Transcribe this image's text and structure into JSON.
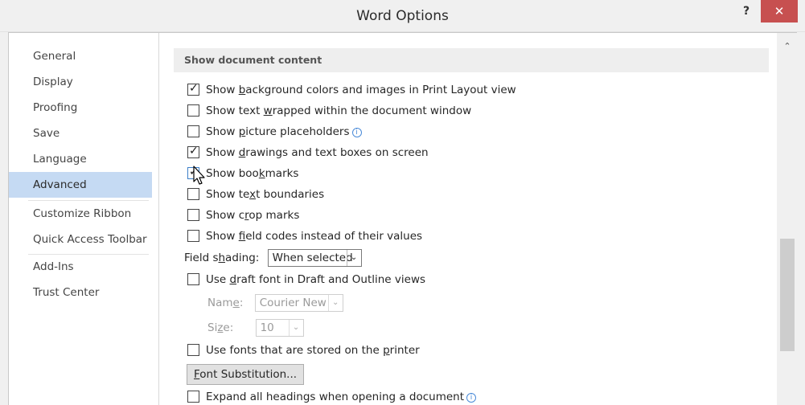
{
  "window": {
    "title": "Word Options",
    "help_label": "?",
    "close_label": "✕"
  },
  "sidebar": {
    "items": [
      {
        "label": "General"
      },
      {
        "label": "Display"
      },
      {
        "label": "Proofing"
      },
      {
        "label": "Save"
      },
      {
        "label": "Language"
      },
      {
        "label": "Advanced",
        "selected": true
      },
      {
        "label": "Customize Ribbon"
      },
      {
        "label": "Quick Access Toolbar"
      },
      {
        "label": "Add-Ins"
      },
      {
        "label": "Trust Center"
      }
    ]
  },
  "main": {
    "section_title": "Show document content",
    "options": [
      {
        "pre": "Show ",
        "u": "b",
        "post": "ackground colors and images in Print Layout view",
        "checked": true
      },
      {
        "pre": "Show text ",
        "u": "w",
        "post": "rapped within the document window",
        "checked": false
      },
      {
        "pre": "Show ",
        "u": "p",
        "post": "icture placeholders",
        "checked": false,
        "info": true
      },
      {
        "pre": "Show ",
        "u": "d",
        "post": "rawings and text boxes on screen",
        "checked": true
      },
      {
        "pre": "Show boo",
        "u": "k",
        "post": "marks",
        "checked": true
      },
      {
        "pre": "Show te",
        "u": "x",
        "post": "t boundaries",
        "checked": false
      },
      {
        "pre": "Show c",
        "u": "r",
        "post": "op marks",
        "checked": false
      },
      {
        "pre": "Show ",
        "u": "f",
        "post": "ield codes instead of their values",
        "checked": false
      }
    ],
    "field_shading": {
      "label_pre": "Field s",
      "label_u": "h",
      "label_post": "ading:",
      "value": "When selected"
    },
    "draft_font": {
      "pre": "Use ",
      "u": "d",
      "post": "raft font in Draft and Outline views",
      "checked": false
    },
    "name_field": {
      "label_pre": "Nam",
      "label_u": "e",
      "label_post": ":",
      "value": "Courier New"
    },
    "size_field": {
      "label_pre": "Si",
      "label_u": "z",
      "label_post": "e:",
      "value": "10"
    },
    "printer_fonts": {
      "pre": "Use fonts that are stored on the ",
      "u": "p",
      "post": "rinter",
      "checked": false
    },
    "font_substitution": {
      "u": "F",
      "post": "ont Substitution..."
    },
    "expand_headings": {
      "pre": "Expand all headings when opening a document",
      "checked": false,
      "info": true
    }
  },
  "icons": {
    "info": "information-icon",
    "dropdown": "chevron-down-icon",
    "scroll_up": "chevron-up-icon",
    "cursor": "mouse-pointer-icon"
  },
  "colors": {
    "selected_nav": "#c5daf3",
    "close_button": "#c75050",
    "info_icon": "#4a8bd8"
  }
}
